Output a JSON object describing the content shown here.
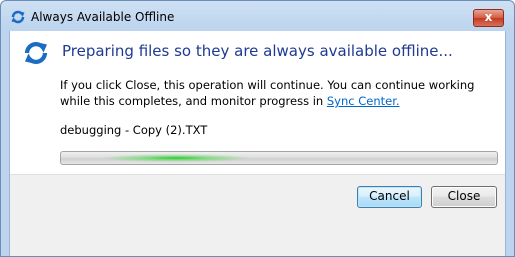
{
  "window": {
    "title": "Always Available Offline",
    "close_glyph": "x"
  },
  "dialog": {
    "heading": "Preparing files so they are always available offline...",
    "description": "If you click Close, this operation will continue.  You can continue working while this completes, and monitor progress in ",
    "link_text": "Sync Center.",
    "current_file": "debugging - Copy (2).TXT",
    "progress_style": "indeterminate"
  },
  "buttons": {
    "cancel": "Cancel",
    "close": "Close"
  },
  "icons": {
    "title": "sync-icon",
    "main": "sync-icon"
  },
  "colors": {
    "heading": "#1e3a92",
    "link": "#0066cc",
    "progress_glow": "#22c822",
    "titlebar": "#bcd4ee"
  }
}
